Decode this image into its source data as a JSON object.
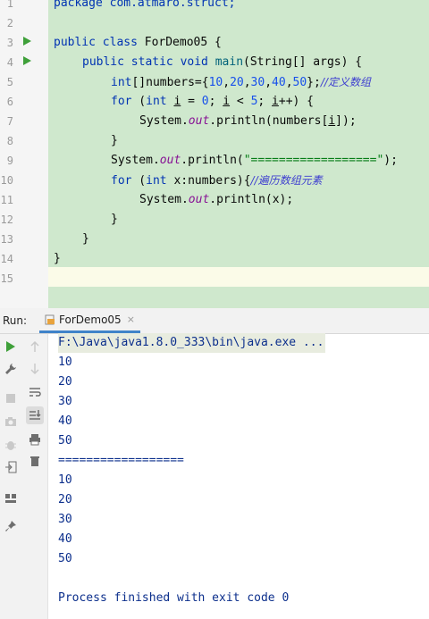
{
  "editor": {
    "line_numbers": [
      "1",
      "2",
      "3",
      "4",
      "5",
      "6",
      "7",
      "8",
      "9",
      "10",
      "11",
      "12",
      "13",
      "14",
      "15"
    ],
    "lines": {
      "l1": "package com.atmaro.struct;",
      "l3_kw": "public class",
      "l3_rest": " ForDemo05 {",
      "l4_kw": "public static void",
      "l4_m": " main",
      "l4_rest": "(String[] args) {",
      "l5_a": "int",
      "l5_b": "[]numbers={",
      "l5_n1": "10",
      "l5_n2": "20",
      "l5_n3": "30",
      "l5_n4": "40",
      "l5_n5": "50",
      "l5_c": "};",
      "l5_cmt": "//定义数组",
      "l6_for": "for",
      "l6_a": " (",
      "l6_int": "int",
      "l6_i": "i",
      "l6_b": " = ",
      "l6_0": "0",
      "l6_c": "; ",
      "l6_i2": "i",
      "l6_d": " < ",
      "l6_5": "5",
      "l6_e": "; ",
      "l6_i3": "i",
      "l6_f": "++) {",
      "l7_a": "System.",
      "l7_out": "out",
      "l7_b": ".println(numbers[",
      "l7_i": "i",
      "l7_c": "]);",
      "l8": "}",
      "l9_a": "System.",
      "l9_out": "out",
      "l9_b": ".println(",
      "l9_str": "\"==================\"",
      "l9_c": ");",
      "l10_for": "for",
      "l10_a": " (",
      "l10_int": "int",
      "l10_b": " x:numbers){",
      "l10_cmt": "//遍历数组元素",
      "l11_a": "System.",
      "l11_out": "out",
      "l11_b": ".println(x);",
      "l12": "}",
      "l13": "}",
      "l14": "}"
    }
  },
  "run_panel": {
    "label": "Run:",
    "tab": "ForDemo05",
    "tab_close": "×",
    "output": [
      "F:\\Java\\java1.8.0_333\\bin\\java.exe ...",
      "10",
      "20",
      "30",
      "40",
      "50",
      "==================",
      "10",
      "20",
      "30",
      "40",
      "50",
      "",
      "Process finished with exit code 0"
    ]
  },
  "colors": {
    "selection": "#cfe8cd",
    "run_green": "#3fa03a",
    "keyword": "#0033b3",
    "number": "#1750eb",
    "string": "#067d17",
    "field": "#871094"
  },
  "icons": [
    "run-icon",
    "rerun-up-icon",
    "wrench-icon",
    "scroll-down-icon",
    "stop-icon",
    "soft-wrap-icon",
    "camera-icon",
    "scroll-to-end-icon",
    "debug-bug-icon",
    "print-icon",
    "exit-icon",
    "trash-icon",
    "layout-icon",
    "pin-icon",
    "file-java-icon"
  ]
}
